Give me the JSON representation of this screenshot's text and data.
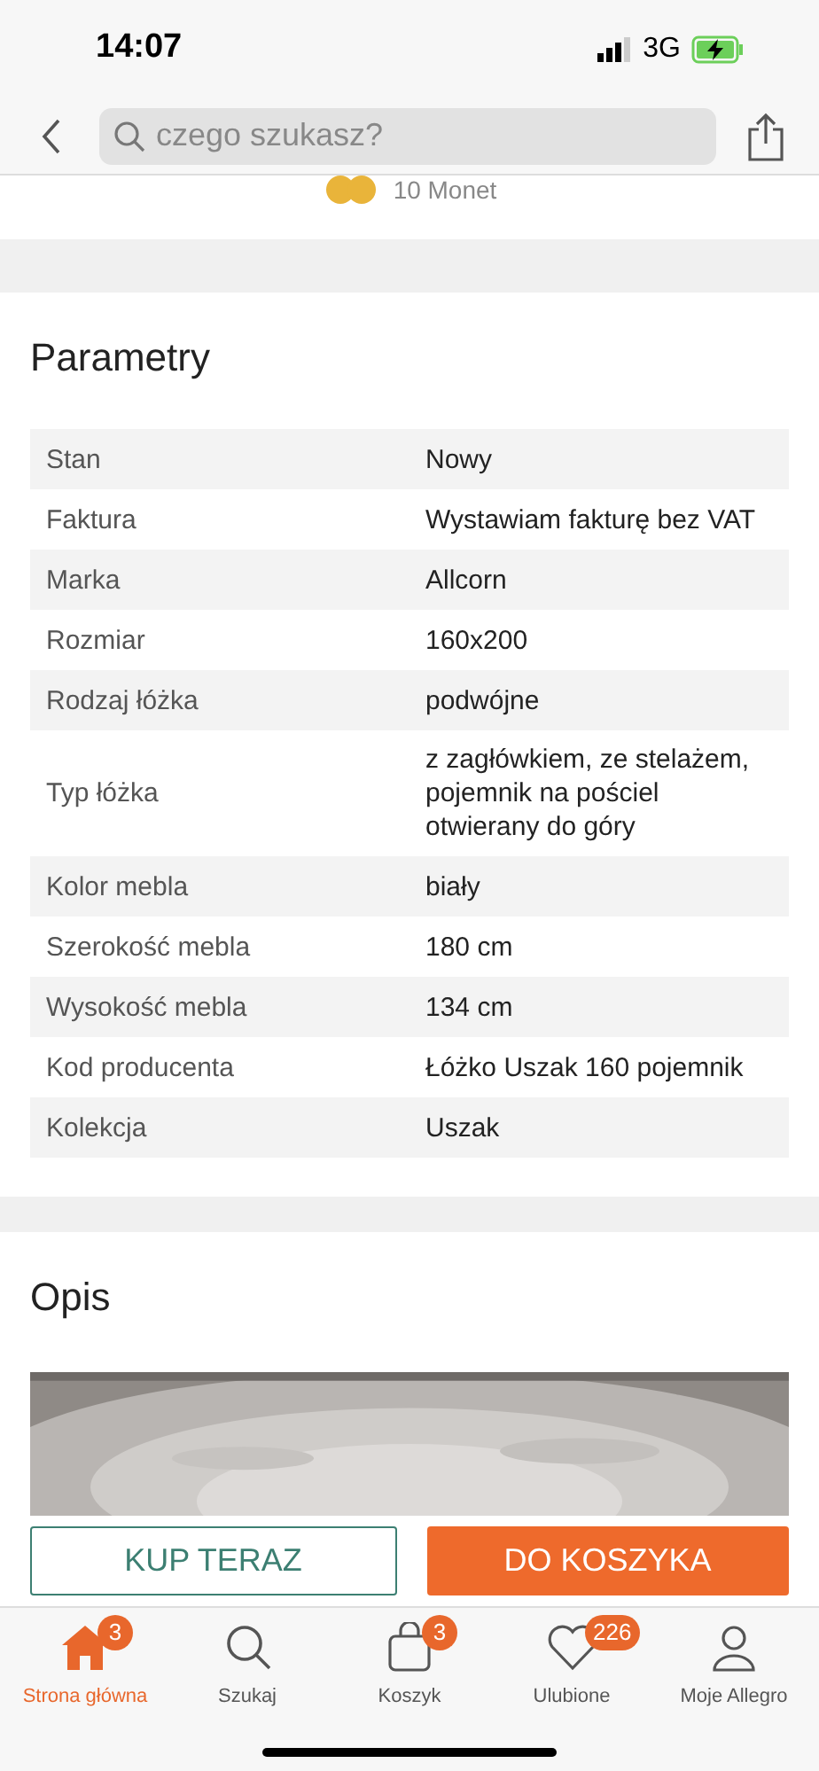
{
  "status_bar": {
    "time": "14:07",
    "network": "3G"
  },
  "header": {
    "search": {
      "placeholder": "czego szukasz?"
    }
  },
  "coins": {
    "label": "10 Monet"
  },
  "parameters": {
    "title": "Parametry",
    "rows": [
      {
        "name": "Stan",
        "value": "Nowy"
      },
      {
        "name": "Faktura",
        "value": "Wystawiam fakturę bez VAT"
      },
      {
        "name": "Marka",
        "value": "Allcorn"
      },
      {
        "name": "Rozmiar",
        "value": "160x200"
      },
      {
        "name": "Rodzaj łóżka",
        "value": "podwójne"
      },
      {
        "name": "Typ łóżka",
        "value": "z zagłówkiem, ze stelażem, pojemnik na pościel otwierany do góry"
      },
      {
        "name": "Kolor mebla",
        "value": "biały"
      },
      {
        "name": "Szerokość mebla",
        "value": "180 cm"
      },
      {
        "name": "Wysokość mebla",
        "value": "134 cm"
      },
      {
        "name": "Kod producenta",
        "value": "Łóżko Uszak 160 pojemnik"
      },
      {
        "name": "Kolekcja",
        "value": "Uszak"
      }
    ]
  },
  "description": {
    "title": "Opis"
  },
  "actions": {
    "buy_now": "KUP TERAZ",
    "add_to_cart": "DO KOSZYKA"
  },
  "tab_bar": [
    {
      "kind": "home",
      "label": "Strona główna",
      "selected": true,
      "badge": "3"
    },
    {
      "kind": "search",
      "label": "Szukaj",
      "selected": false
    },
    {
      "kind": "cart",
      "label": "Koszyk",
      "selected": false,
      "badge": "3"
    },
    {
      "kind": "favorites",
      "label": "Ulubione",
      "selected": false,
      "badge": "226"
    },
    {
      "kind": "account",
      "label": "Moje Allegro",
      "selected": false
    }
  ]
}
